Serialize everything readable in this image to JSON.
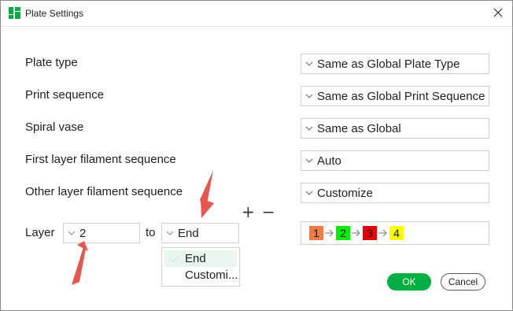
{
  "window": {
    "title": "Plate Settings",
    "icon": "bambu-logo-icon"
  },
  "rows": [
    {
      "label": "Plate type",
      "value": "Same as Global Plate Type"
    },
    {
      "label": "Print sequence",
      "value": "Same as Global Print Sequence"
    },
    {
      "label": "Spiral vase",
      "value": "Same as Global"
    },
    {
      "label": "First layer filament sequence",
      "value": "Auto"
    },
    {
      "label": "Other layer filament sequence",
      "value": "Customize"
    }
  ],
  "layer": {
    "label": "Layer",
    "from_value": "2",
    "to_label": "to",
    "to_value": "End",
    "add_symbol": "+",
    "remove_symbol": "−"
  },
  "sequence": [
    {
      "number": "1",
      "color": "#f47a42"
    },
    {
      "number": "2",
      "color": "#00ee00"
    },
    {
      "number": "3",
      "color": "#ee0000"
    },
    {
      "number": "4",
      "color": "#ffff00"
    }
  ],
  "dropdown": {
    "options": [
      "End",
      "Customi..."
    ],
    "selected": "End"
  },
  "buttons": {
    "ok": "OK",
    "cancel": "Cancel"
  },
  "colors": {
    "accent": "#00ae42",
    "annotation": "#e8554e"
  }
}
